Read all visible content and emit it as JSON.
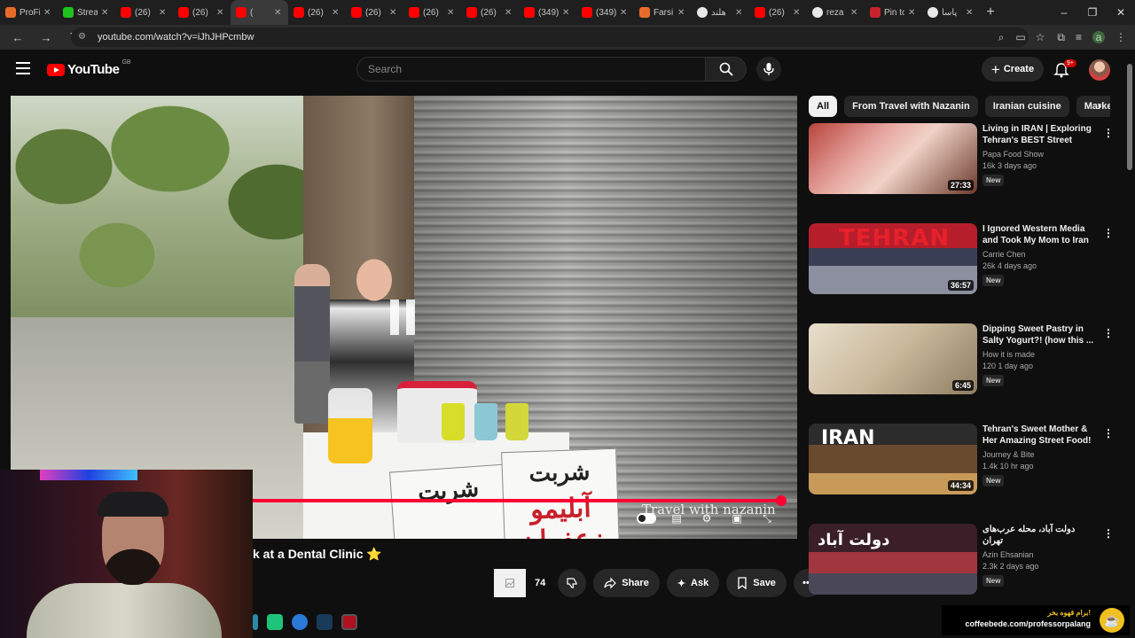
{
  "browser": {
    "tabs": [
      {
        "title": "ProFi",
        "favicon": "user-photo-favicon"
      },
      {
        "title": "Strea",
        "favicon": "kick-favicon"
      },
      {
        "title": "(26)",
        "favicon": "youtube-favicon"
      },
      {
        "title": "(26)",
        "favicon": "youtube-favicon"
      },
      {
        "title": "(",
        "favicon": "youtube-favicon",
        "active": true
      },
      {
        "title": "(26)",
        "favicon": "youtube-favicon"
      },
      {
        "title": "(26)",
        "favicon": "youtube-favicon"
      },
      {
        "title": "(26)",
        "favicon": "youtube-favicon"
      },
      {
        "title": "(26)",
        "favicon": "youtube-favicon"
      },
      {
        "title": "(349)",
        "favicon": "youtube-favicon"
      },
      {
        "title": "(349)",
        "favicon": "youtube-favicon"
      },
      {
        "title": "Farsi",
        "favicon": "farsi-favicon"
      },
      {
        "title": "هلند",
        "favicon": "google-favicon"
      },
      {
        "title": "(26)",
        "favicon": "youtube-favicon"
      },
      {
        "title": "reza",
        "favicon": "google-favicon"
      },
      {
        "title": "Pin to",
        "favicon": "pin-favicon"
      },
      {
        "title": "پاسا",
        "favicon": "google-favicon"
      }
    ],
    "url": "youtube.com/watch?v=iJhJHPcmbw",
    "colors": {
      "tab_bg": "#1f1f1f",
      "active_tab": "#3a3a3a",
      "omnibox": "#202020"
    }
  },
  "youtube": {
    "logo_text": "YouTube",
    "region": "GB",
    "search": {
      "placeholder": "Search"
    },
    "create_label": "Create",
    "notification_count": "9+"
  },
  "player": {
    "watermark": "Travel with nazanin",
    "progress": 0.98,
    "sign_left": "شربت",
    "sign_right_top": "شربت",
    "sign_right_bottom": "آبلیمو زعفران"
  },
  "video": {
    "title_partial": "k at a Dental Clinic",
    "title_emoji": "⭐",
    "like_count": "74",
    "share_label": "Share",
    "ask_label": "Ask",
    "save_label": "Save"
  },
  "chips": [
    "All",
    "From Travel with Nazanin",
    "Iranian cuisine",
    "Market"
  ],
  "recommendations": [
    {
      "title": "Living in IRAN | Exploring Tehran's BEST Street Food!",
      "channel": "Papa Food Show",
      "meta": "16k  3 days ago",
      "badge": "New",
      "duration": "27:33",
      "thumb_text": ""
    },
    {
      "title": "I Ignored Western Media and Took My Mom to Iran ɪʀ ...",
      "channel": "Carrie Chen",
      "meta": "26k  4 days ago",
      "badge": "New",
      "duration": "36:57",
      "thumb_text": "TEHRAN"
    },
    {
      "title": "Dipping Sweet Pastry in Salty Yogurt?! (how this ...",
      "channel": "How it is made",
      "meta": "120  1 day ago",
      "badge": "New",
      "duration": "6:45",
      "thumb_text": ""
    },
    {
      "title": "Tehran's Sweet Mother & Her Amazing Street Food! ɪʀ ...",
      "channel": "Journey & Bite",
      "meta": "1.4k  10 hr ago",
      "badge": "New",
      "duration": "44:34",
      "thumb_text": "IRAN"
    },
    {
      "title": "دولت آباد، محله عرب‌های تهران",
      "channel": "Azin Ehsanian",
      "meta": "2.3k  2 days ago",
      "badge": "New",
      "duration": "",
      "thumb_text": "دولت آباد"
    }
  ],
  "promo": {
    "text": "برام قهوه بخر!",
    "url": "coffeebede.com/professorpalang"
  }
}
